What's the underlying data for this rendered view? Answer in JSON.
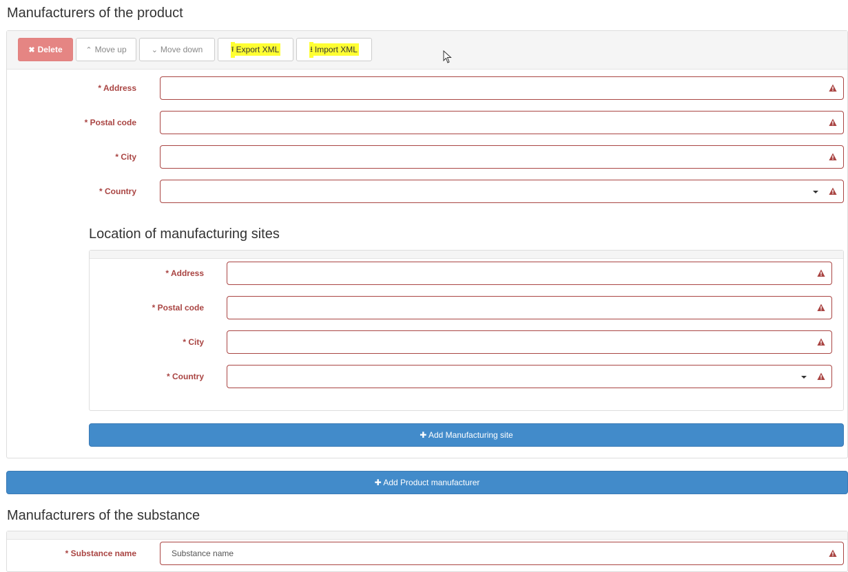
{
  "product_section": {
    "title": "Manufacturers of the product",
    "toolbar": {
      "delete_label": "Delete",
      "move_up_label": "Move up",
      "move_down_label": "Move down",
      "export_label": "Export XML",
      "import_label": "Import XML"
    },
    "fields": [
      {
        "label": "* Address",
        "value": ""
      },
      {
        "label": "* Postal code",
        "value": ""
      },
      {
        "label": "* City",
        "value": ""
      },
      {
        "label": "* Country",
        "value": ""
      }
    ],
    "sites": {
      "title": "Location of manufacturing sites",
      "fields": [
        {
          "label": "* Address",
          "value": ""
        },
        {
          "label": "* Postal code",
          "value": ""
        },
        {
          "label": "* City",
          "value": ""
        },
        {
          "label": "* Country",
          "value": ""
        }
      ],
      "add_label": "Add Manufacturing site"
    },
    "add_label": "Add Product manufacturer"
  },
  "substance_section": {
    "title": "Manufacturers of the substance",
    "fields": [
      {
        "label": "* Substance name",
        "placeholder": "Substance name"
      }
    ]
  },
  "colors": {
    "error": "#a94442",
    "primary": "#428bca",
    "danger": "#e58583",
    "highlight": "#ffff33"
  },
  "icons": [
    "times-icon",
    "chevron-up-icon",
    "chevron-down-icon",
    "upload-icon",
    "download-icon",
    "warning-icon",
    "plus-icon",
    "caret-down-icon",
    "mouse-cursor"
  ]
}
